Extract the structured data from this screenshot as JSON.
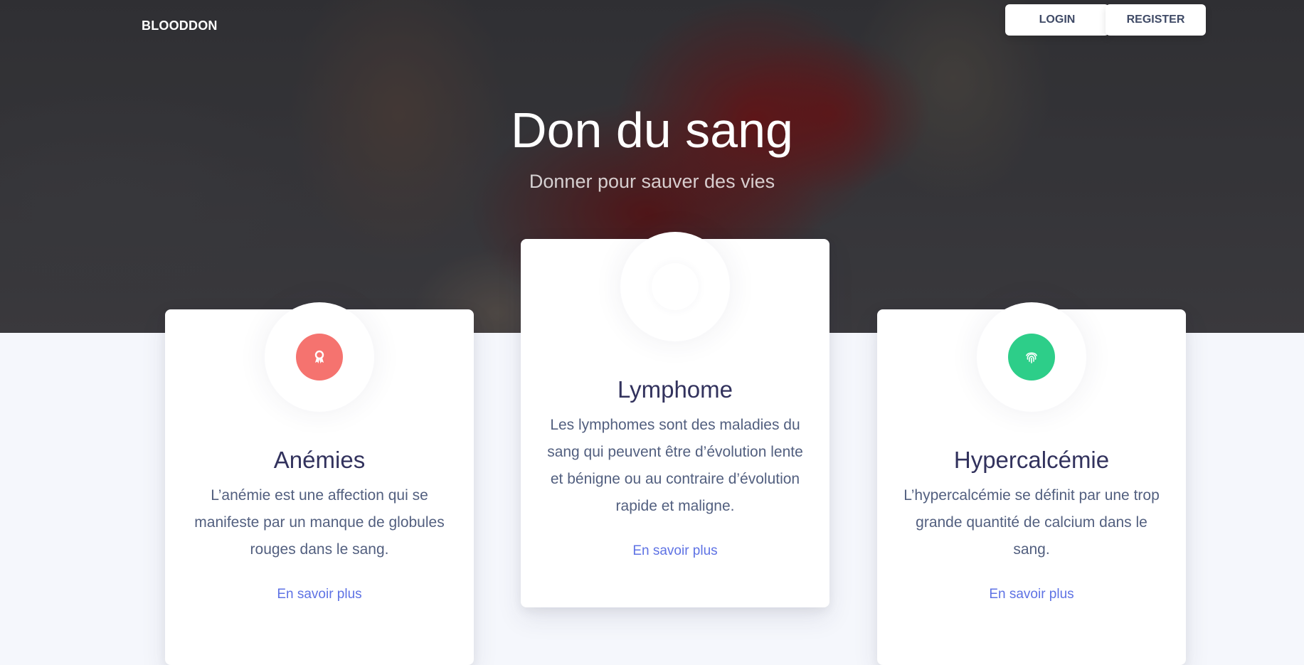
{
  "nav": {
    "brand": "BLOODDON",
    "login_label": "LOGIN",
    "register_label": "REGISTER"
  },
  "hero": {
    "title": "Don du sang",
    "subtitle": "Donner pour sauver des vies"
  },
  "cards": [
    {
      "title": "Anémies",
      "text": "L’anémie est une affection qui se manifeste par un manque de globules rouges dans le sang.",
      "link": "En savoir plus",
      "icon": "award-icon",
      "icon_color": "#f5736f"
    },
    {
      "title": "Lymphome",
      "text": "Les lymphomes sont des maladies du sang qui peuvent être d’évolution lente et bénigne ou au contraire d’évolution rapide et maligne.",
      "link": "En savoir plus",
      "icon": "blank-icon",
      "icon_color": "#ffffff"
    },
    {
      "title": "Hypercalcémie",
      "text": "L’hypercalcémie se définit par une trop grande quantité de calcium dans le sang.",
      "link": "En savoir plus",
      "icon": "fingerprint-icon",
      "icon_color": "#2dce89"
    }
  ],
  "colors": {
    "accent": "#5e72e4",
    "heading": "#32325d",
    "text": "#525f7f",
    "page_bg": "#f5f7fc"
  }
}
